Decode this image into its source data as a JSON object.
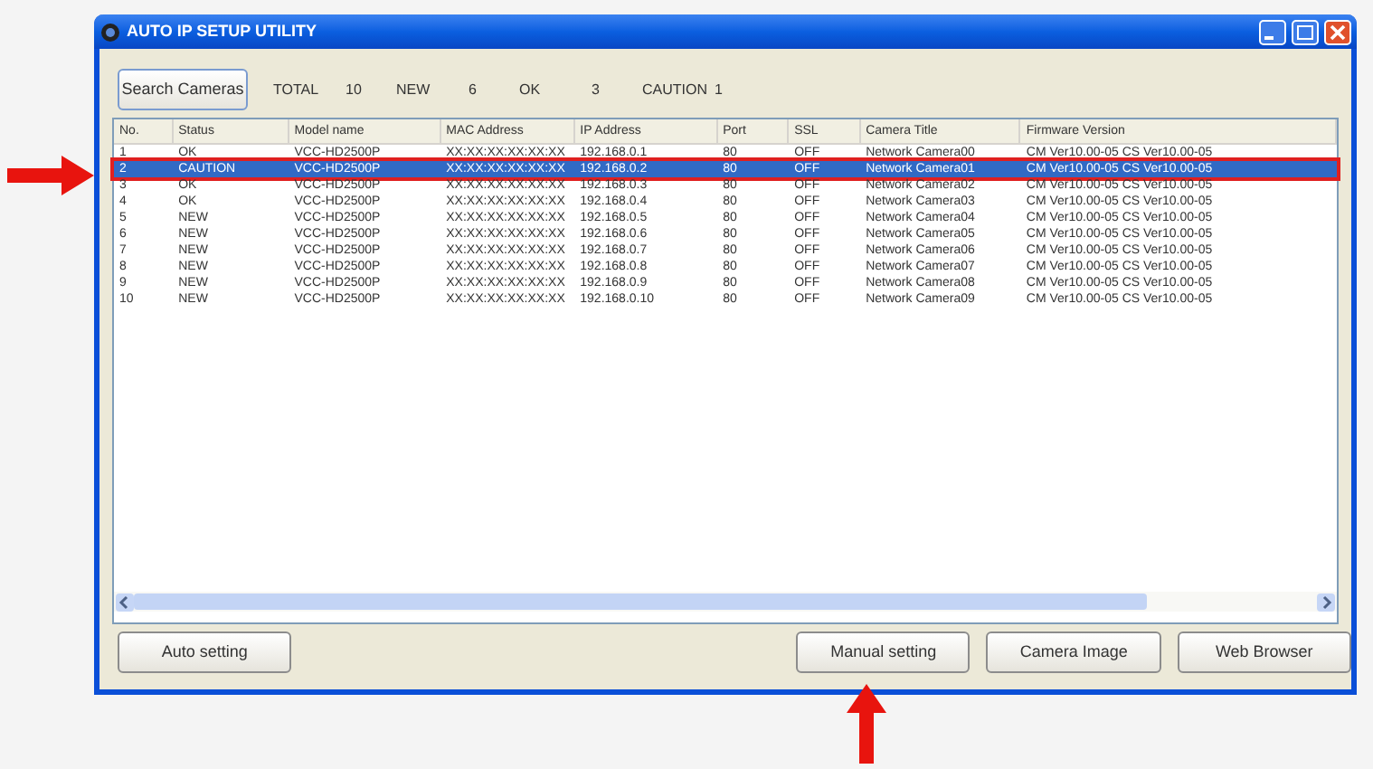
{
  "window": {
    "title": "AUTO IP SETUP UTILITY"
  },
  "search_button": "Search Cameras",
  "summary": [
    {
      "label": "TOTAL",
      "value": "10"
    },
    {
      "label": "NEW",
      "value": "6"
    },
    {
      "label": "OK",
      "value": "3"
    },
    {
      "label": "CAUTION",
      "value": "1"
    }
  ],
  "table": {
    "columns": [
      "No.",
      "Status",
      "Model name",
      "MAC Address",
      "IP Address",
      "Port",
      "SSL",
      "Camera Title",
      "Firmware Version"
    ],
    "rows": [
      {
        "selected": false,
        "cells": [
          "1",
          "OK",
          "VCC-HD2500P",
          "XX:XX:XX:XX:XX:XX",
          "192.168.0.1",
          "80",
          "OFF",
          "Network Camera00",
          "CM Ver10.00-05 CS Ver10.00-05"
        ]
      },
      {
        "selected": true,
        "cells": [
          "2",
          "CAUTION",
          "VCC-HD2500P",
          "XX:XX:XX:XX:XX:XX",
          "192.168.0.2",
          "80",
          "OFF",
          "Network Camera01",
          "CM Ver10.00-05 CS Ver10.00-05"
        ]
      },
      {
        "selected": false,
        "cells": [
          "3",
          "OK",
          "VCC-HD2500P",
          "XX:XX:XX:XX:XX:XX",
          "192.168.0.3",
          "80",
          "OFF",
          "Network Camera02",
          "CM Ver10.00-05 CS Ver10.00-05"
        ]
      },
      {
        "selected": false,
        "cells": [
          "4",
          "OK",
          "VCC-HD2500P",
          "XX:XX:XX:XX:XX:XX",
          "192.168.0.4",
          "80",
          "OFF",
          "Network Camera03",
          "CM Ver10.00-05 CS Ver10.00-05"
        ]
      },
      {
        "selected": false,
        "cells": [
          "5",
          "NEW",
          "VCC-HD2500P",
          "XX:XX:XX:XX:XX:XX",
          "192.168.0.5",
          "80",
          "OFF",
          "Network Camera04",
          "CM Ver10.00-05 CS Ver10.00-05"
        ]
      },
      {
        "selected": false,
        "cells": [
          "6",
          "NEW",
          "VCC-HD2500P",
          "XX:XX:XX:XX:XX:XX",
          "192.168.0.6",
          "80",
          "OFF",
          "Network Camera05",
          "CM Ver10.00-05 CS Ver10.00-05"
        ]
      },
      {
        "selected": false,
        "cells": [
          "7",
          "NEW",
          "VCC-HD2500P",
          "XX:XX:XX:XX:XX:XX",
          "192.168.0.7",
          "80",
          "OFF",
          "Network Camera06",
          "CM Ver10.00-05 CS Ver10.00-05"
        ]
      },
      {
        "selected": false,
        "cells": [
          "8",
          "NEW",
          "VCC-HD2500P",
          "XX:XX:XX:XX:XX:XX",
          "192.168.0.8",
          "80",
          "OFF",
          "Network Camera07",
          "CM Ver10.00-05 CS Ver10.00-05"
        ]
      },
      {
        "selected": false,
        "cells": [
          "9",
          "NEW",
          "VCC-HD2500P",
          "XX:XX:XX:XX:XX:XX",
          "192.168.0.9",
          "80",
          "OFF",
          "Network Camera08",
          "CM Ver10.00-05 CS Ver10.00-05"
        ]
      },
      {
        "selected": false,
        "cells": [
          "10",
          "NEW",
          "VCC-HD2500P",
          "XX:XX:XX:XX:XX:XX",
          "192.168.0.10",
          "80",
          "OFF",
          "Network Camera09",
          "CM Ver10.00-05 CS Ver10.00-05"
        ]
      }
    ]
  },
  "buttons": [
    "Auto setting",
    "Manual setting",
    "Camera Image",
    "Web Browser"
  ]
}
